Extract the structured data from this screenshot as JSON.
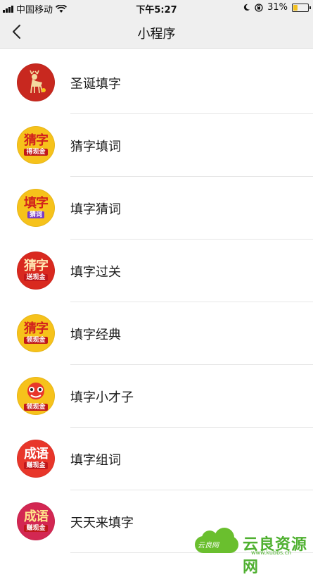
{
  "status_bar": {
    "carrier": "中国移动",
    "time": "下午5:27",
    "battery_percent": "31%",
    "battery_level": 0.31
  },
  "nav": {
    "title": "小程序",
    "back_icon": "chevron-left-icon"
  },
  "apps": [
    {
      "name": "圣诞填字",
      "icon_text": "",
      "icon_sub": "",
      "bg": "#c8281f",
      "fg": "#f3d9a0"
    },
    {
      "name": "猜字填词",
      "icon_text": "猜字",
      "icon_sub": "得现金",
      "bg": "#f6c21b",
      "fg": "#d1201d"
    },
    {
      "name": "填字猜词",
      "icon_text": "填字",
      "icon_sub": "猜词",
      "bg": "#f6c21b",
      "fg": "#d1201d"
    },
    {
      "name": "填字过关",
      "icon_text": "猜字",
      "icon_sub": "送现金",
      "bg": "#d9291f",
      "fg": "#ffe9b5"
    },
    {
      "name": "填字经典",
      "icon_text": "猜字",
      "icon_sub": "领现金",
      "bg": "#f6c21b",
      "fg": "#d1201d"
    },
    {
      "name": "填字小才子",
      "icon_text": "",
      "icon_sub": "领现金",
      "bg": "#f6c21b",
      "fg": "#d1201d"
    },
    {
      "name": "填字组词",
      "icon_text": "成语",
      "icon_sub": "赚现金",
      "bg": "#e8362a",
      "fg": "#ffffff"
    },
    {
      "name": "天天来填字",
      "icon_text": "成语",
      "icon_sub": "赚现金",
      "bg": "#d32752",
      "fg": "#ffe28a"
    }
  ],
  "watermark": {
    "small": "云良网",
    "text": "云良资源网",
    "url": "www.kubbs.cn"
  }
}
